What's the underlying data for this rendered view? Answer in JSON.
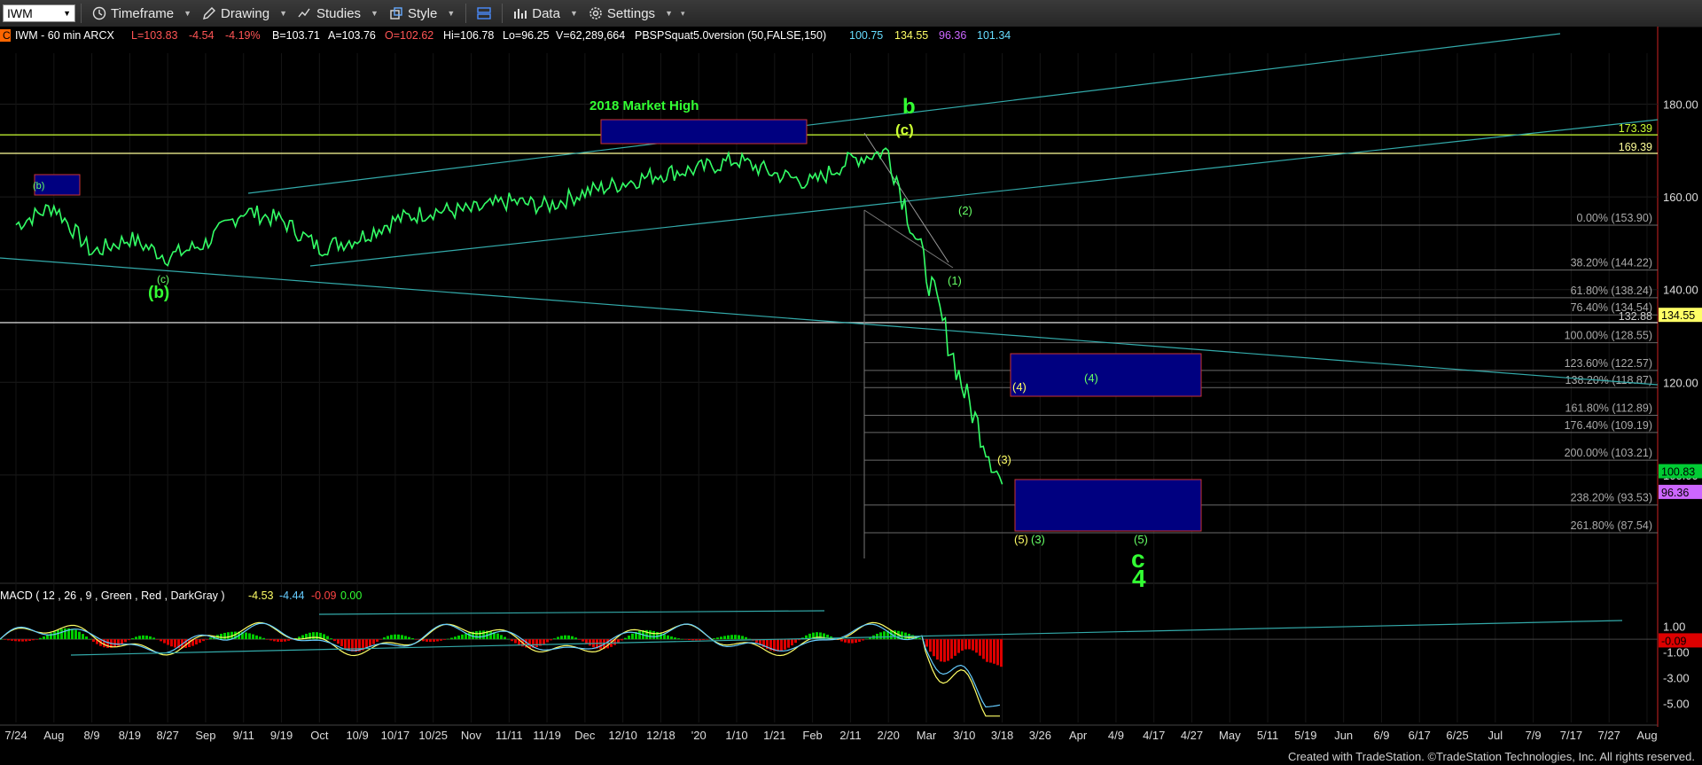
{
  "toolbar": {
    "symbol": "IWM",
    "timeframe": "Timeframe",
    "drawing": "Drawing",
    "studies": "Studies",
    "style": "Style",
    "data": "Data",
    "settings": "Settings"
  },
  "header": {
    "badge": "C",
    "symbol_line": "IWM - 60 min  ARCX",
    "last": "L=103.83",
    "change": "-4.54",
    "pct": "-4.19%",
    "bid": "B=103.71",
    "ask": "A=103.76",
    "open": "O=102.62",
    "high": "Hi=106.78",
    "low": "Lo=96.25",
    "volume": "V=62,289,664",
    "study": "PBSPSquat5.0version (50,FALSE,150)",
    "v1": "100.75",
    "v2": "134.55",
    "v3": "96.36",
    "v4": "101.34"
  },
  "macd_header": {
    "label": "MACD ( 12 , 26 , 9 , Green , Red , DarkGray )",
    "v1": "-4.53",
    "v2": "-4.44",
    "v3": "-0.09",
    "v4": "0.00"
  },
  "chart_data": {
    "type": "line",
    "title": "",
    "price_axis_ticks": [
      "180.00",
      "160.00",
      "140.00",
      "120.00",
      "100.00"
    ],
    "price_range": [
      82,
      191
    ],
    "macd_axis_ticks": [
      "1.00",
      "-1.00",
      "-3.00",
      "-5.00"
    ],
    "macd_range": [
      -6.5,
      2.5
    ],
    "date_ticks": [
      "7/24",
      "Aug",
      "8/9",
      "8/19",
      "8/27",
      "Sep",
      "9/11",
      "9/19",
      "Oct",
      "10/9",
      "10/17",
      "10/25",
      "Nov",
      "11/11",
      "11/19",
      "Dec",
      "12/10",
      "12/18",
      "'20",
      "1/10",
      "1/21",
      "Feb",
      "2/11",
      "2/20",
      "Mar",
      "3/10",
      "3/18",
      "3/26",
      "Apr",
      "4/9",
      "4/17",
      "4/27",
      "May",
      "5/11",
      "5/19",
      "Jun",
      "6/9",
      "6/17",
      "6/25",
      "Jul",
      "7/9",
      "7/17",
      "7/27",
      "Aug"
    ],
    "price_series": {
      "x": [
        "7/24",
        "Aug",
        "8/9",
        "8/19",
        "8/27",
        "Sep",
        "9/11",
        "9/19",
        "Oct",
        "10/9",
        "10/17",
        "10/25",
        "Nov",
        "11/11",
        "11/19",
        "Dec",
        "12/10",
        "12/18",
        "'20",
        "1/10",
        "1/21",
        "Feb",
        "2/11",
        "2/20",
        "Mar",
        "3/10",
        "3/18"
      ],
      "y": [
        154,
        158,
        148,
        151,
        147,
        150,
        157,
        155,
        149,
        151,
        155,
        157,
        157,
        159,
        158,
        161,
        163,
        165,
        166,
        168,
        165,
        163,
        168,
        170,
        144,
        118,
        98
      ]
    },
    "fib_levels": [
      {
        "label": "0.00% (153.90)",
        "value": 153.9
      },
      {
        "label": "38.20% (144.22)",
        "value": 144.22
      },
      {
        "label": "61.80% (138.24)",
        "value": 138.24
      },
      {
        "label": "76.40% (134.54)",
        "value": 134.54
      },
      {
        "label": "100.00% (128.55)",
        "value": 128.55
      },
      {
        "label": "123.60% (122.57)",
        "value": 122.57
      },
      {
        "label": "138.20% (118.87)",
        "value": 118.87
      },
      {
        "label": "161.80% (112.89)",
        "value": 112.89
      },
      {
        "label": "176.40% (109.19)",
        "value": 109.19
      },
      {
        "label": "200.00% (103.21)",
        "value": 103.21
      },
      {
        "label": "238.20% (93.53)",
        "value": 93.53
      },
      {
        "label": "261.80% (87.54)",
        "value": 87.54
      }
    ],
    "horizontal_levels": [
      {
        "label": "173.39",
        "value": 173.39,
        "color": "#ccff33"
      },
      {
        "label": "169.39",
        "value": 169.39,
        "color": "#ffff99"
      },
      {
        "label": "132.88",
        "value": 132.88,
        "color": "#cccccc"
      }
    ],
    "price_badges": [
      {
        "label": "134.55",
        "value": 134.55,
        "color": "#ffff66"
      },
      {
        "label": "100.83",
        "value": 100.83,
        "color": "#00cc33"
      },
      {
        "label": "96.36",
        "value": 96.36,
        "color": "#cc66ff"
      }
    ],
    "annotations": {
      "market_high": "2018 Market High",
      "b_main": "b",
      "c_paren_top": "(c)",
      "b_small": "(b)",
      "b_large": "(b)",
      "c_small": "(c)",
      "w1": "(1)",
      "w2": "(2)",
      "w3y": "(3)",
      "w4y": "(4)",
      "w5y": "(5)",
      "w3g": "(3)",
      "w4g": "(4)",
      "w5g": "(5)",
      "c_big": "c",
      "four_big": "4"
    }
  },
  "footer": {
    "text": "Created with TradeStation. ©TradeStation Technologies, Inc. All rights reserved."
  },
  "colors": {
    "price": "#33ff66",
    "fib": "#777777",
    "trendline": "#33aaaa",
    "macd_hist_pos": "#00cc00",
    "macd_hist_neg": "#dd0000",
    "box_fill": "#000080",
    "box_border": "#cc3333"
  }
}
